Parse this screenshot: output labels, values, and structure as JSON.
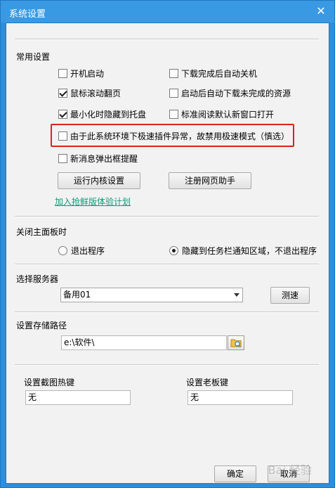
{
  "window": {
    "title": "系统设置",
    "close_glyph": "✕"
  },
  "common": {
    "heading": "常用设置",
    "left_options": [
      {
        "label": "开机启动",
        "checked": false
      },
      {
        "label": "鼠标滚动翻页",
        "checked": true
      },
      {
        "label": "最小化时隐藏到托盘",
        "checked": true
      }
    ],
    "right_options": [
      {
        "label": "下载完成后自动关机",
        "checked": false
      },
      {
        "label": "启动后自动下载未完成的资源",
        "checked": false
      },
      {
        "label": "标准阅读默认新窗口打开",
        "checked": false
      }
    ],
    "highlight_option": {
      "label": "由于此系统环境下极速插件异常，故禁用极速模式（慎选）",
      "checked": false
    },
    "popup_option": {
      "label": "新消息弹出框提醒",
      "checked": false
    },
    "kernel_button": "运行内核设置",
    "register_button": "注册网页助手",
    "experience_link": "加入抢鲜版体验计划"
  },
  "close_panel": {
    "heading": "关闭主面板时",
    "options": [
      {
        "label": "退出程序",
        "checked": false
      },
      {
        "label": "隐藏到任务栏通知区域，不退出程序",
        "checked": true
      }
    ]
  },
  "server": {
    "heading": "选择服务器",
    "selected": "备用01",
    "test_button": "测速"
  },
  "storage": {
    "heading": "设置存储路径",
    "path": "e:\\软件\\"
  },
  "hotkeys": {
    "screenshot_label": "设置截图热键",
    "screenshot_value": "无",
    "boss_label": "设置老板键",
    "boss_value": "无"
  },
  "footer": {
    "ok_button": "确定",
    "cancel_button": "取消"
  },
  "watermark": "Bai 经验"
}
